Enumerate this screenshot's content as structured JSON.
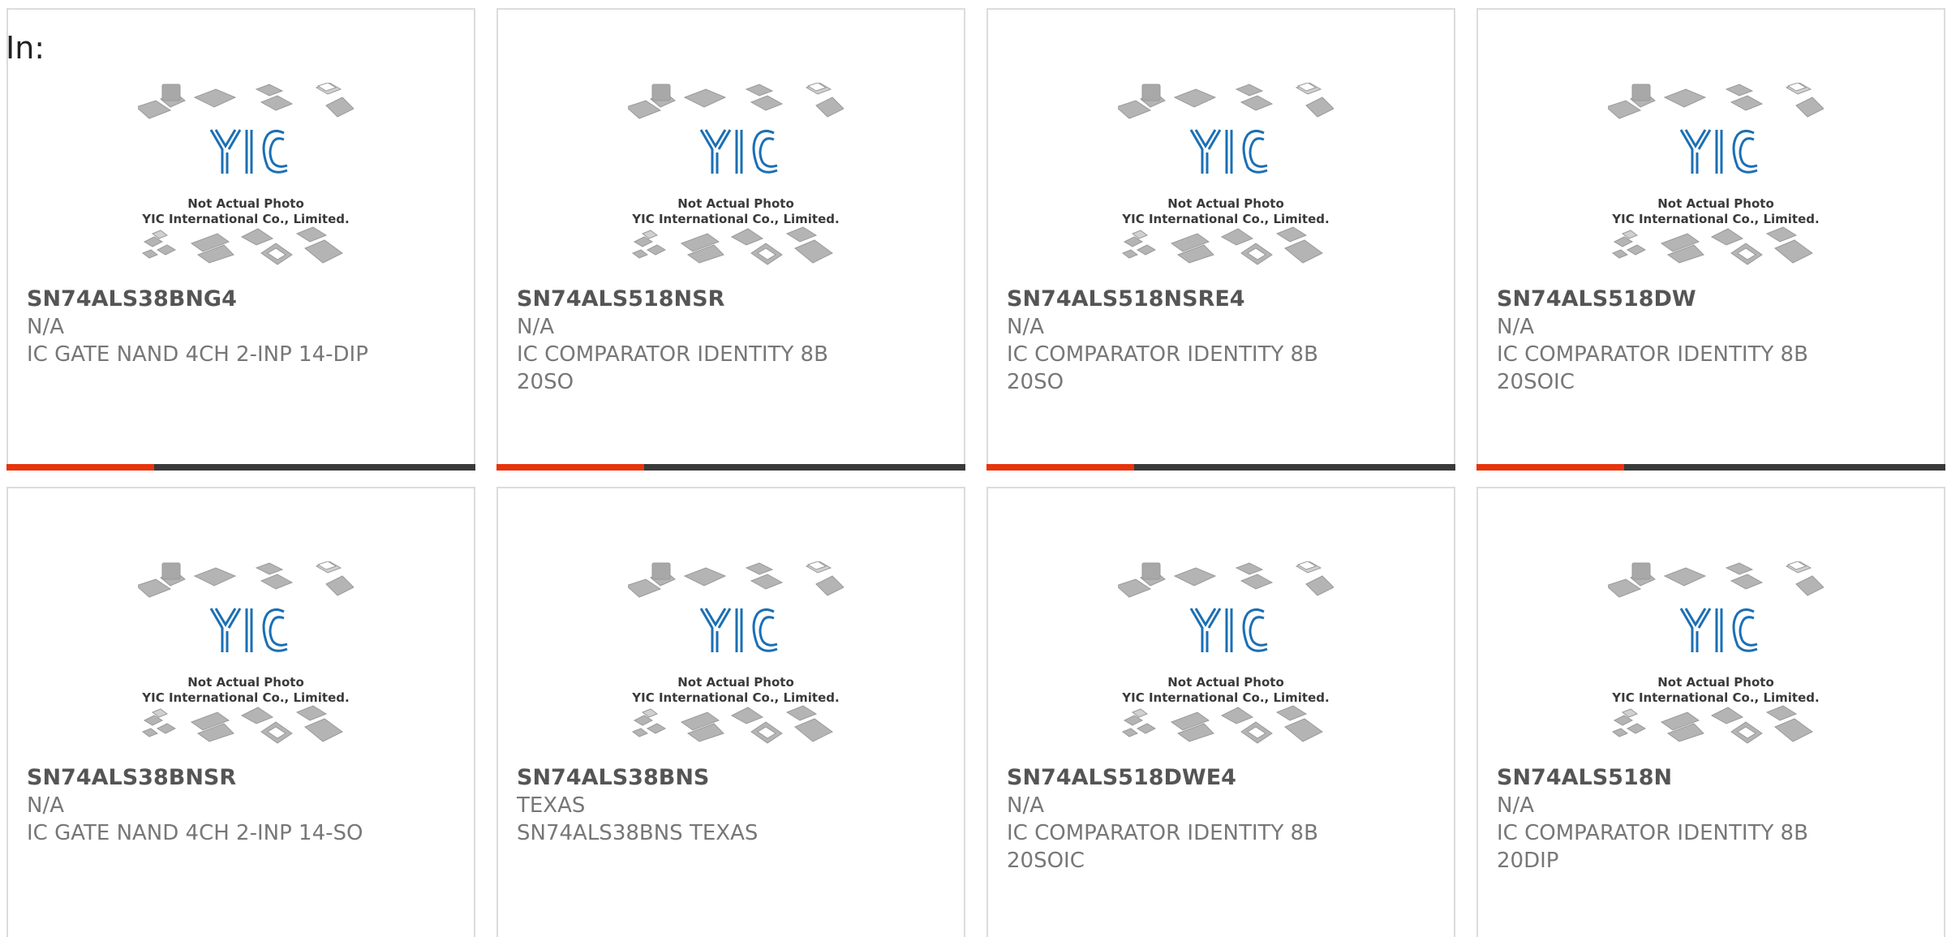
{
  "filter_label": "In:",
  "photo_caption": {
    "line1": "Not Actual Photo",
    "line2": "YIC International Co., Limited.",
    "logo_text": "YIC"
  },
  "colors": {
    "accent": "#e8340e",
    "bar": "#3a3a3a",
    "logo": "#1a6fb5"
  },
  "products": [
    {
      "part": "SN74ALS38BNG4",
      "manufacturer": "N/A",
      "description": "IC GATE NAND 4CH 2-INP 14-DIP"
    },
    {
      "part": "SN74ALS518NSR",
      "manufacturer": "N/A",
      "description": "IC COMPARATOR IDENTITY 8B 20SO"
    },
    {
      "part": "SN74ALS518NSRE4",
      "manufacturer": "N/A",
      "description": "IC COMPARATOR IDENTITY 8B 20SO"
    },
    {
      "part": "SN74ALS518DW",
      "manufacturer": "N/A",
      "description": "IC COMPARATOR IDENTITY 8B 20SOIC"
    },
    {
      "part": "SN74ALS38BNSR",
      "manufacturer": "N/A",
      "description": "IC GATE NAND 4CH 2-INP 14-SO"
    },
    {
      "part": "SN74ALS38BNS",
      "manufacturer": "TEXAS",
      "description": "SN74ALS38BNS TEXAS"
    },
    {
      "part": "SN74ALS518DWE4",
      "manufacturer": "N/A",
      "description": "IC COMPARATOR IDENTITY 8B 20SOIC"
    },
    {
      "part": "SN74ALS518N",
      "manufacturer": "N/A",
      "description": "IC COMPARATOR IDENTITY 8B 20DIP"
    }
  ]
}
